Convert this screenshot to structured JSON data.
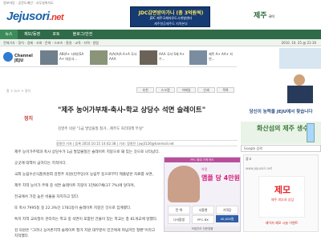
{
  "topbar": {
    "links": "정보마당 · 공문도메인 · 사무실위치도"
  },
  "logo": {
    "main": "Jejusori",
    "ext": ".net"
  },
  "tagline": "",
  "banner": {
    "line1": "JDC감면받아가니 (총 3억원씩)",
    "line2": "JDC 제주국제자유도시개발센터",
    "line3": "제주항공제주도 지역본부"
  },
  "site_logo": {
    "name": "제주",
    "sub": "국어"
  },
  "nav": {
    "tabs": [
      "뉴스",
      "제보/동영",
      "포토",
      "블로그/안전"
    ]
  },
  "subnav": {
    "text": "전체기사 · 정치 · 경제 · 사회 · 문화 · 스포츠 · 환경 · 교육 · 지역 · 칼럼",
    "date": "2010. 10. 25 @ 21:16"
  },
  "channel": {
    "label": "Channel JEJU"
  },
  "ticker": [
    {
      "text": "AB(A+ 사회)(SA A+ 대상사..."
    },
    {
      "text": "A(A(A(A A+A 국사 AAA"
    },
    {
      "text": "AAA 국서 S제 A+ 수..."
    },
    {
      "text": "제주 A+ AA+ 자연..."
    }
  ],
  "breadcrumb": "홈 > 뉴스 > 정치",
  "tools": [
    "추천",
    "스크랩",
    "이메일",
    "인쇄",
    "목록"
  ],
  "article": {
    "section": "정치",
    "headline": "\"제주 농어가부채-축사-학교 상당수 석면 슬레이트\"",
    "subhead": "김영주 의원 \"1급 발암물질 철거…제주도 처리대책 부실\"",
    "meta": "장원진 기자 | 등록 2010.10.15 14:42:38 | 기사: 장원진 | jwj3126@hanmail.net",
    "paragraphs": [
      "제주 농어가주택과 축사 상당수가 1급 발암물질인 슬레이트 지붕으로 돼 있는 것으로 나타났다.",
      "곳곳에 대책이 급하다는 지적이다.",
      "국회 농림수산식품위원회 김영주 의원(민주당)이 농림부 등으로부터 제출받은 자료를 보면,",
      "제주 지역 농어가 주택 중 석면 슬레이트 지붕이 1만807채(37.7%)에 달하며,",
      "전국에서 가장 높은 비율을 차지하고 있다.",
      "또 축사 7995동 중 22.3%인 1781동이 슬레이트 지붕인 것으로 집계됐다.",
      "특히 지역 교육청이 관리하는 학교 중 석면이 포함된 건물이 있는 학교는 총 81개교에 달했다.",
      "김 의원은 \"그러나 농어촌지역 슬레이트 철거 지원 대부분이 민간에게 떠넘겨진 형편\"이라고 지적했다."
    ]
  },
  "ad_mid": {
    "top": "PFC 휴대 가격 카드",
    "t1": "약정",
    "t2": "앰플 당 4만원",
    "row1": [
      "탄 엑",
      "사용엔",
      "가격당"
    ],
    "row2": [
      "나서합생",
      "PFC-RX",
      "40,000원"
    ],
    "foot": "모발관리 전문앰플"
  },
  "right": {
    "banner1": "당신이 능력을 JEJU에서 찾습니다",
    "banner2": "화산섬의 제주 생수",
    "search_label": "Google 검색",
    "block_title": "광고",
    "block_url": "www.jejusori.net",
    "big_text": "제모",
    "small_text": "제주 피부과 상담",
    "foot_text": "레이저 제모 시술 이벤트"
  },
  "colors": {
    "nav_bg": "#2f6b48",
    "logo_blue": "#1d64a8",
    "logo_red": "#e23b2d",
    "headline_red": "#c33",
    "ad_pink": "#d21f75"
  }
}
